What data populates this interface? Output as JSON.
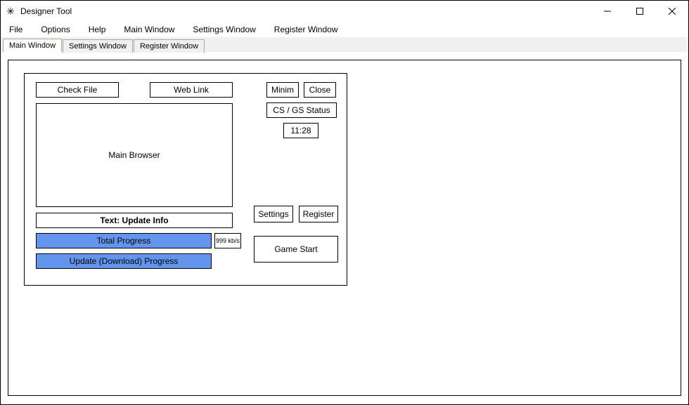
{
  "window": {
    "title": "Designer Tool"
  },
  "menubar": {
    "items": [
      "File",
      "Options",
      "Help",
      "Main Window",
      "Settings Window",
      "Register Window"
    ]
  },
  "tabs": {
    "items": [
      "Main Window",
      "Settings Window",
      "Register Window"
    ],
    "active": 0
  },
  "panel": {
    "check_file": "Check File",
    "web_link": "Web Link",
    "main_browser": "Main Browser",
    "update_info": "Text: Update Info",
    "total_progress": "Total Progress",
    "speed": "999 kb/s",
    "download_progress": "Update (Download) Progress",
    "minim": "Minim",
    "close": "Close",
    "csgs": "CS / GS Status",
    "time": "11:28",
    "settings": "Settings",
    "register": "Register",
    "game_start": "Game Start"
  }
}
